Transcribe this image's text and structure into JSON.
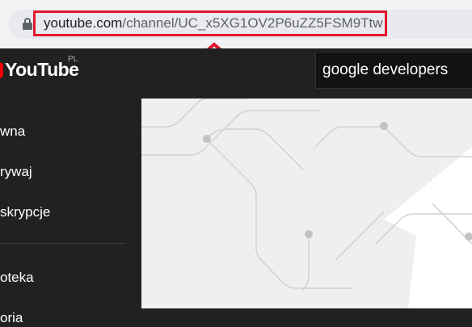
{
  "browser": {
    "url_domain": "youtube.com",
    "url_path": "/channel/UC_x5XG1OV2P6uZZ5FSM9Ttw"
  },
  "header": {
    "logo_text": "YouTube",
    "region": "PL",
    "search_value": "google developers"
  },
  "sidebar": {
    "items": [
      {
        "label": "wna"
      },
      {
        "label": "rywaj"
      },
      {
        "label": "skrypcje"
      },
      {
        "label": "oteka"
      },
      {
        "label": "oria"
      }
    ]
  },
  "colors": {
    "annotation": "#e0182e",
    "background": "#212121"
  }
}
